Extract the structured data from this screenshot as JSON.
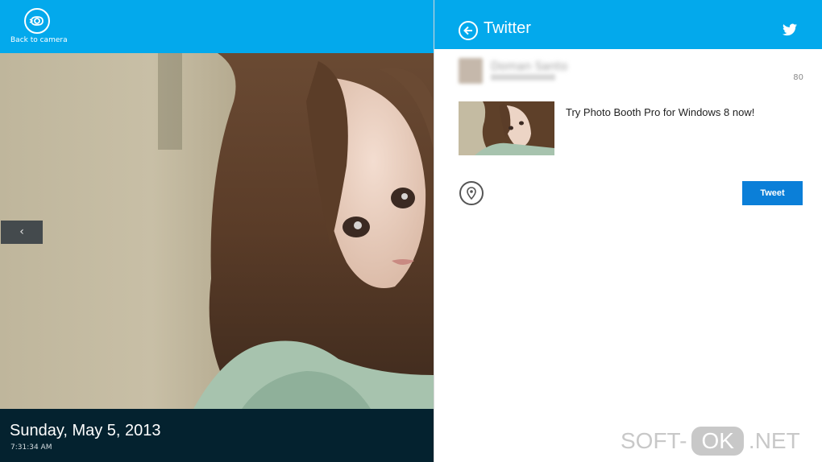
{
  "viewer": {
    "back_to_camera_label": "Back to camera",
    "prev_label": "‹",
    "date": "Sunday, May 5, 2013",
    "time": "7:31:34 AM",
    "photo_subject": "portrait-photo"
  },
  "share": {
    "title": "Twitter",
    "account_name": "Doman Santo",
    "char_count": "80",
    "message": "Try Photo Booth Pro for Windows 8 now!",
    "tweet_label": "Tweet"
  },
  "watermark": {
    "left": "SOFT-",
    "pill": "OK",
    "right": ".NET"
  },
  "colors": {
    "accent": "#03a9ec",
    "footer": "#04222f",
    "tweet_button": "#0b7fd8"
  },
  "icons": [
    "camera-icon",
    "chevron-left-icon",
    "back-arrow-icon",
    "twitter-bird-icon",
    "location-pin-icon"
  ]
}
